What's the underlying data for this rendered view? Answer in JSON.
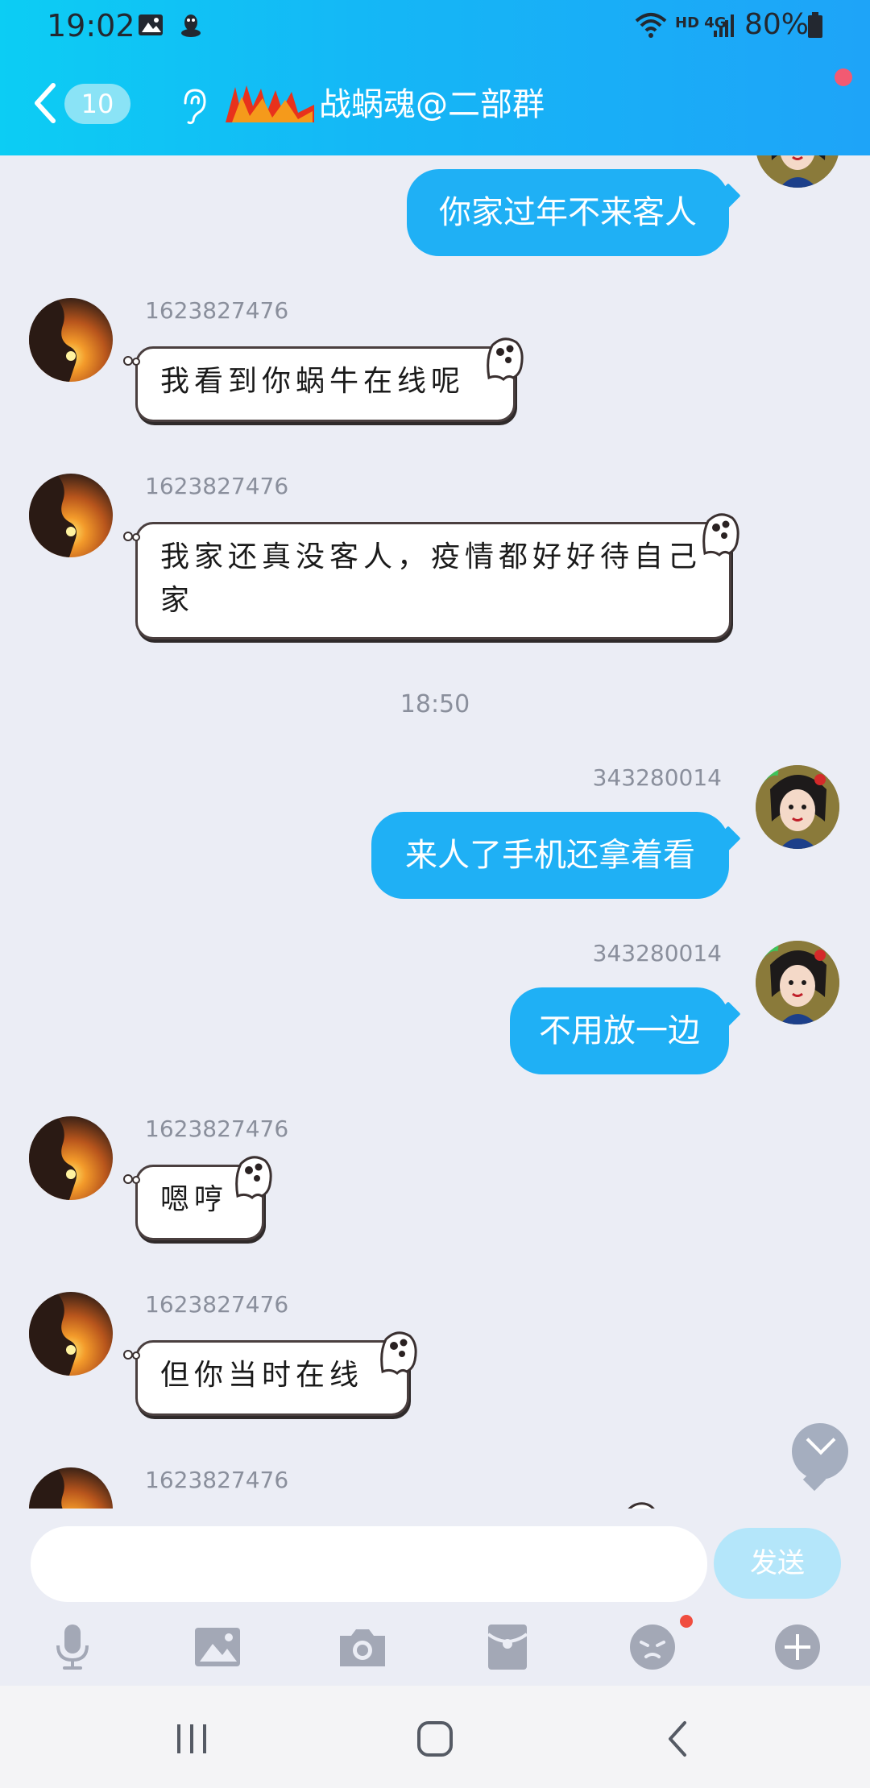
{
  "status_bar": {
    "time": "19:02",
    "network": "HD 4G",
    "battery": "80%"
  },
  "header": {
    "unread_count": "10",
    "title": "战蜗魂@二部群"
  },
  "messages": [
    {
      "side": "out",
      "text": "你家过年不来客人"
    },
    {
      "side": "in",
      "sender": "1623827476",
      "text": "我看到你蜗牛在线呢"
    },
    {
      "side": "in",
      "sender": "1623827476",
      "text": "我家还真没客人，疫情都好好待自己家"
    },
    {
      "timestamp": "18:50"
    },
    {
      "side": "out",
      "sender": "343280014",
      "text": "来人了手机还拿着看"
    },
    {
      "side": "out",
      "sender": "343280014",
      "text": "不用放一边"
    },
    {
      "side": "in",
      "sender": "1623827476",
      "text": "嗯哼"
    },
    {
      "side": "in",
      "sender": "1623827476",
      "text": "但你当时在线"
    },
    {
      "side": "in",
      "sender": "1623827476",
      "text": ""
    }
  ],
  "composer": {
    "placeholder": "",
    "send_label": "发送"
  },
  "toolbar_icons": [
    "microphone-icon",
    "image-icon",
    "camera-icon",
    "red-packet-icon",
    "emoji-icon",
    "plus-icon"
  ],
  "nav_icons": [
    "recent-apps-icon",
    "home-icon",
    "back-icon"
  ],
  "colors": {
    "header_start": "#0ccdf4",
    "header_end": "#1ea4f8",
    "outgoing_bubble": "#1fb0f5",
    "background": "#ebedf5",
    "send_button": "#b4e6fa"
  }
}
